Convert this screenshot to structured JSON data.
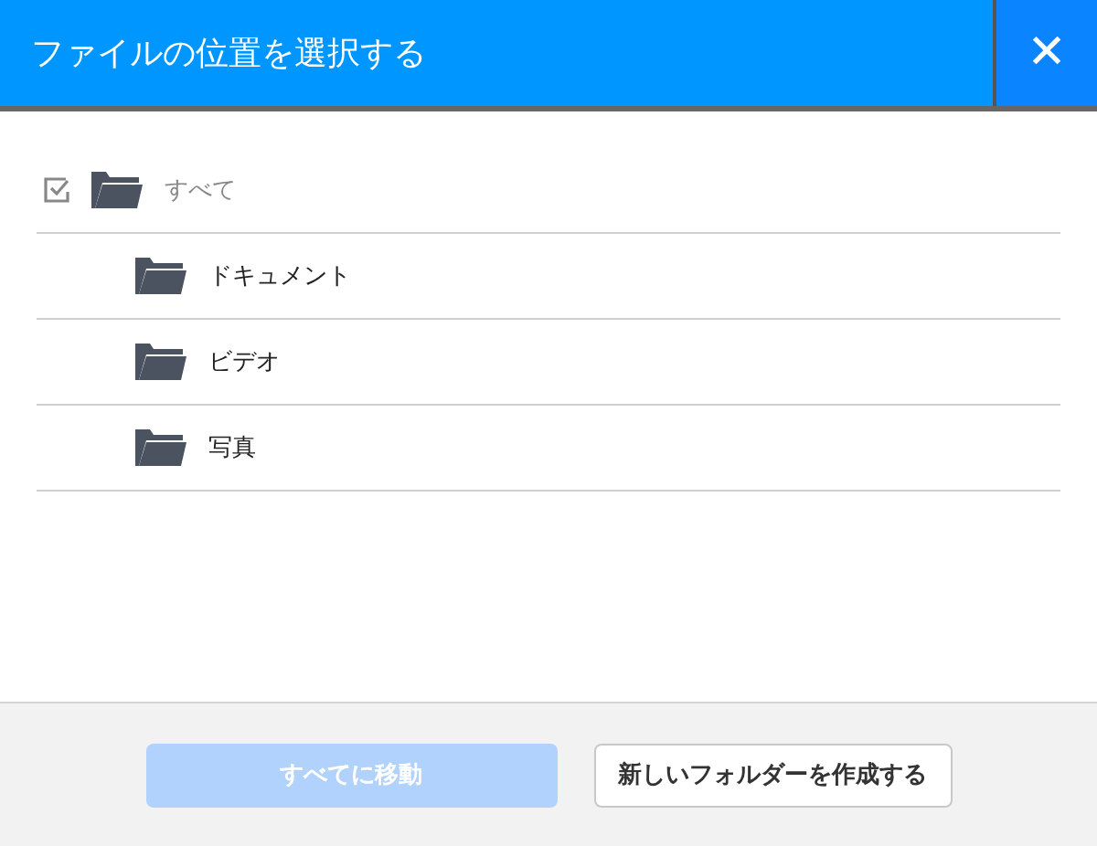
{
  "dialog": {
    "title": "ファイルの位置を選択する",
    "close_label": "✕"
  },
  "tree": {
    "label": "すべて",
    "checked": true,
    "disabled": true,
    "children": [
      {
        "label": "ドキュメント"
      },
      {
        "label": "ビデオ"
      },
      {
        "label": "写真"
      }
    ]
  },
  "buttons": [
    {
      "label": "すべてに移動",
      "kind": "primary",
      "disabled": true
    },
    {
      "label": "新しいフォルダーを作成する",
      "kind": "secondary",
      "disabled": false
    }
  ]
}
